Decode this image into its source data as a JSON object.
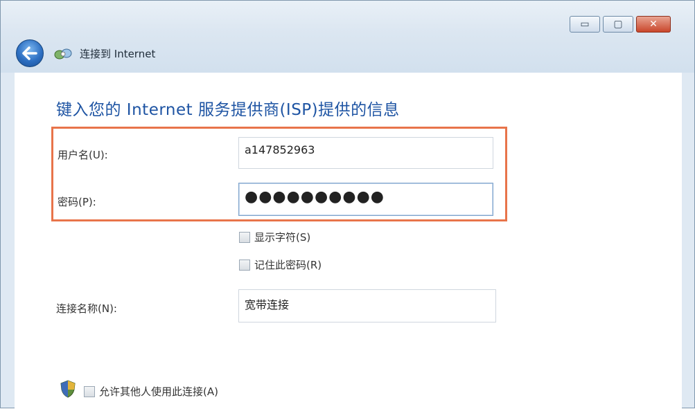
{
  "window": {
    "crumb_title": "连接到 Internet",
    "controls": {
      "minimize": "▭",
      "restore": "▢",
      "close": "✕"
    }
  },
  "page": {
    "heading": "键入您的 Internet 服务提供商(ISP)提供的信息"
  },
  "form": {
    "username_label": "用户名(U):",
    "username_value": "a147852963",
    "password_label": "密码(P):",
    "password_masked": "●●●●●●●●●●",
    "show_chars_label": "显示字符(S)",
    "remember_password_label": "记住此密码(R)",
    "connection_name_label": "连接名称(N):",
    "connection_name_value": "宽带连接",
    "allow_others_label": "允许其他人使用此连接(A)"
  },
  "icons": {
    "back": "back-arrow-icon",
    "network": "network-icon",
    "shield": "shield-icon"
  },
  "colors": {
    "heading": "#1e54a3",
    "highlight": "#e8744a",
    "back_button": "#2d6fc2"
  }
}
